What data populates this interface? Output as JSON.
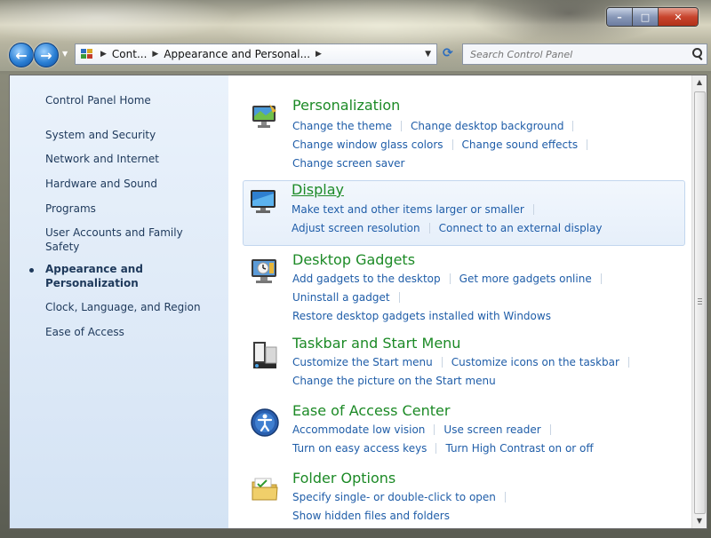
{
  "window": {
    "caption": {
      "minimize_icon": "minimize-icon",
      "maximize_icon": "maximize-icon",
      "close_icon": "close-icon"
    }
  },
  "nav": {
    "back_icon": "back-arrow-icon",
    "forward_icon": "forward-arrow-icon",
    "breadcrumb": [
      "Cont...",
      "Appearance and Personal..."
    ],
    "search_placeholder": "Search Control Panel"
  },
  "sidebar": {
    "home": "Control Panel Home",
    "items": [
      {
        "label": "System and Security"
      },
      {
        "label": "Network and Internet"
      },
      {
        "label": "Hardware and Sound"
      },
      {
        "label": "Programs"
      },
      {
        "label": "User Accounts and Family Safety"
      },
      {
        "label": "Appearance and Personalization",
        "current": true
      },
      {
        "label": "Clock, Language, and Region"
      },
      {
        "label": "Ease of Access"
      }
    ]
  },
  "categories": [
    {
      "title": "Personalization",
      "icon": "personalization-icon",
      "tasks": [
        [
          "Change the theme",
          "Change desktop background"
        ],
        [
          "Change window glass colors",
          "Change sound effects"
        ],
        [
          "Change screen saver"
        ]
      ]
    },
    {
      "title": "Display",
      "icon": "display-icon",
      "highlighted": true,
      "tasks": [
        [
          "Make text and other items larger or smaller"
        ],
        [
          "Adjust screen resolution",
          "Connect to an external display"
        ]
      ]
    },
    {
      "title": "Desktop Gadgets",
      "icon": "desktop-gadgets-icon",
      "tasks": [
        [
          "Add gadgets to the desktop",
          "Get more gadgets online"
        ],
        [
          "Uninstall a gadget"
        ],
        [
          "Restore desktop gadgets installed with Windows"
        ]
      ]
    },
    {
      "title": "Taskbar and Start Menu",
      "icon": "taskbar-icon",
      "tasks": [
        [
          "Customize the Start menu",
          "Customize icons on the taskbar"
        ],
        [
          "Change the picture on the Start menu"
        ]
      ]
    },
    {
      "title": "Ease of Access Center",
      "icon": "ease-of-access-icon",
      "tasks": [
        [
          "Accommodate low vision",
          "Use screen reader"
        ],
        [
          "Turn on easy access keys",
          "Turn High Contrast on or off"
        ]
      ]
    },
    {
      "title": "Folder Options",
      "icon": "folder-options-icon",
      "tasks": [
        [
          "Specify single- or double-click to open"
        ],
        [
          "Show hidden files and folders"
        ]
      ]
    }
  ],
  "colors": {
    "link": "#1f5da8",
    "category_title": "#1c8a26",
    "sidebar_text": "#1e395b"
  }
}
